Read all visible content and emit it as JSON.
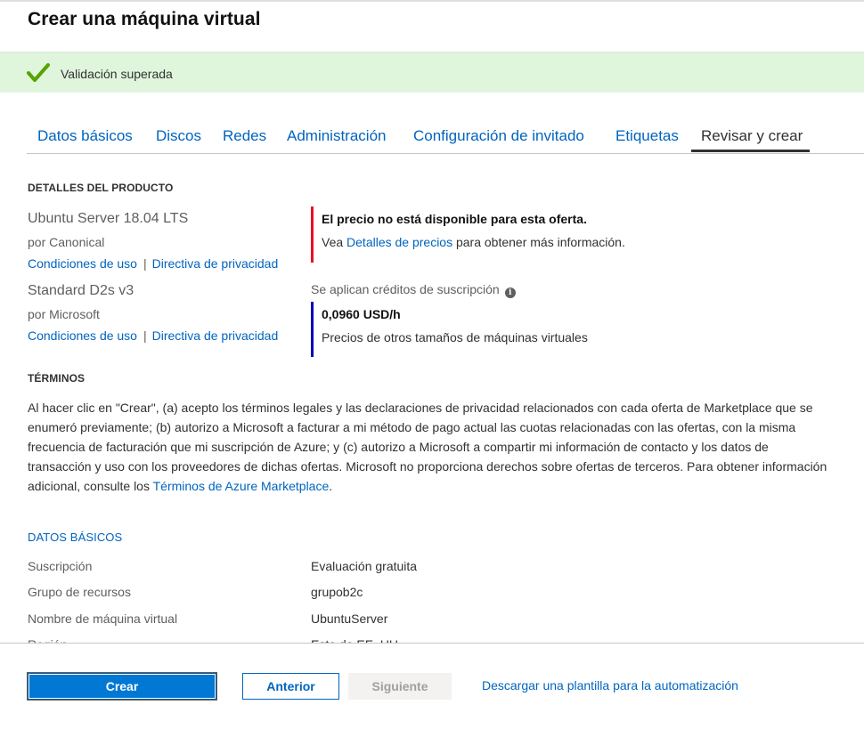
{
  "page": {
    "title": "Crear una máquina virtual"
  },
  "validation": {
    "message": "Validación superada"
  },
  "tabs": [
    {
      "label": "Datos básicos"
    },
    {
      "label": "Discos"
    },
    {
      "label": "Redes"
    },
    {
      "label": "Administración"
    },
    {
      "label": "Configuración de invitado"
    },
    {
      "label": "Etiquetas"
    },
    {
      "label": "Revisar y crear",
      "active": true
    }
  ],
  "product_details": {
    "header": "DETALLES DEL PRODUCTO",
    "products": [
      {
        "name": "Ubuntu Server 18.04 LTS",
        "publisher": "por Canonical",
        "terms_link": "Condiciones de uso",
        "privacy_link": "Directiva de privacidad",
        "separator": "|"
      },
      {
        "name": "Standard D2s v3",
        "publisher": "por Microsoft",
        "terms_link": "Condiciones de uso",
        "privacy_link": "Directiva de privacidad",
        "separator": "|"
      }
    ],
    "price_unavailable": {
      "title": "El precio no está disponible para esta oferta.",
      "prefix": "Vea ",
      "link": "Detalles de precios",
      "suffix": " para obtener más información."
    },
    "credits_note": "Se aplican créditos de suscripción",
    "info_icon": "i",
    "price": "0,0960 USD/h",
    "other_sizes_link": "Precios de otros tamaños de máquinas virtuales"
  },
  "terms": {
    "header": "TÉRMINOS",
    "body": "Al hacer clic en \"Crear\", (a) acepto los términos legales y las declaraciones de privacidad relacionados con cada oferta de Marketplace que se enumeró previamente; (b) autorizo a Microsoft a facturar a mi método de pago actual las cuotas relacionadas con las ofertas, con la misma frecuencia de facturación que mi suscripción de Azure; y (c) autorizo a Microsoft a compartir mi información de contacto y los datos de transacción y uso con los proveedores de dichas ofertas. Microsoft no proporciona derechos sobre ofertas de terceros. Para obtener información adicional, consulte los ",
    "link": "Términos de Azure Marketplace",
    "end": "."
  },
  "basics": {
    "header": "DATOS BÁSICOS",
    "rows": [
      {
        "label": "Suscripción",
        "value": "Evaluación gratuita"
      },
      {
        "label": "Grupo de recursos",
        "value": "grupob2c"
      },
      {
        "label": "Nombre de máquina virtual",
        "value": "UbuntuServer"
      },
      {
        "label": "Región",
        "value": "Este de EE. UU."
      }
    ]
  },
  "footer": {
    "create_label": "Crear",
    "previous_label": "Anterior",
    "next_label": "Siguiente",
    "download_link": "Descargar una plantilla para la automatización"
  },
  "colors": {
    "link_blue": "#0064bf",
    "primary_blue": "#0078d4",
    "success_bg": "#dff6dd",
    "success_check": "#57a300",
    "error_red": "#e81123",
    "price_border": "#0000b8"
  },
  "icons": {
    "validation": "checkmark-icon",
    "info": "info-icon"
  }
}
